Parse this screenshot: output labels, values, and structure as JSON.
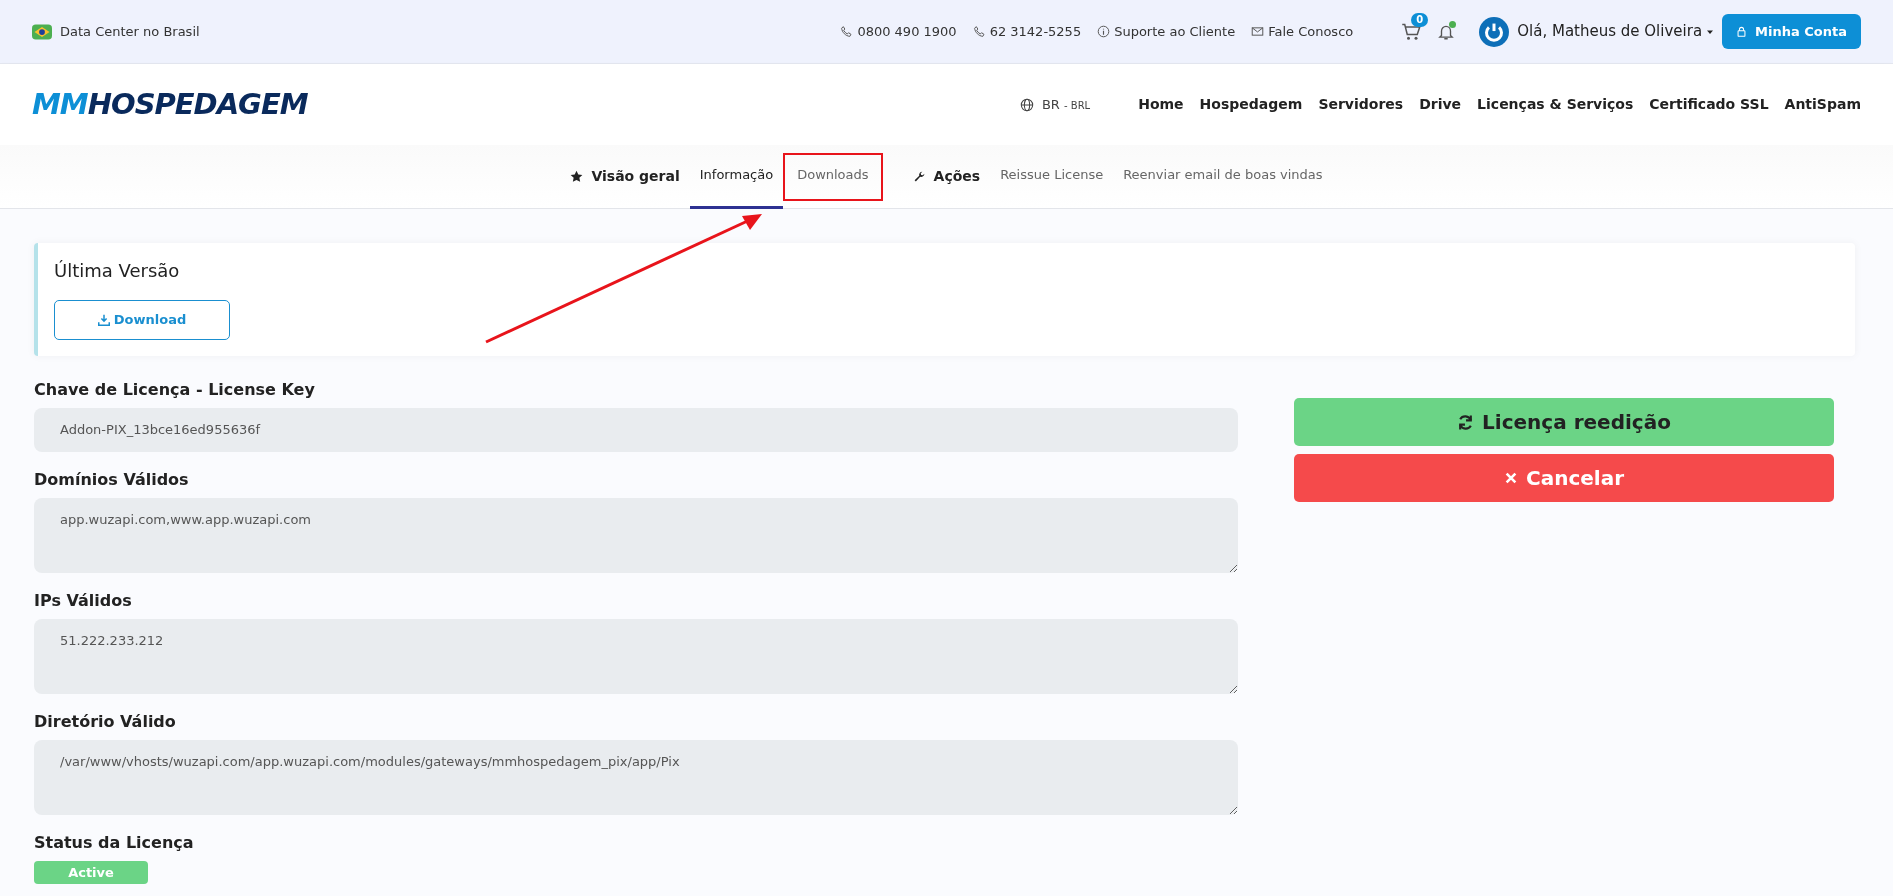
{
  "topbar": {
    "datacenter": "Data Center no Brasil",
    "links": [
      {
        "kind": "phone",
        "label": "0800 490 1900"
      },
      {
        "kind": "phone",
        "label": "62 3142-5255"
      },
      {
        "kind": "info",
        "label": "Suporte ao Cliente"
      },
      {
        "kind": "mail",
        "label": "Fale Conosco"
      }
    ],
    "cart_count": "0",
    "notification_dot": true,
    "greeting": "Olá, Matheus de Oliveira",
    "account_button": "Minha Conta"
  },
  "navbar": {
    "logo_part1": "MM",
    "logo_part2": "HOSPEDAGEM",
    "language": "BR",
    "currency": "- BRL",
    "items": [
      "Home",
      "Hospedagem",
      "Servidores",
      "Drive",
      "Licenças & Serviços",
      "Certificado SSL",
      "AntiSpam"
    ]
  },
  "subnav": [
    {
      "kind": "heading",
      "label": "Visão geral"
    },
    {
      "kind": "link",
      "label": "Informação",
      "selected": true,
      "highlighted": false
    },
    {
      "kind": "link",
      "label": "Downloads",
      "selected": false,
      "highlighted": true
    },
    {
      "kind": "heading",
      "label": "Ações"
    },
    {
      "kind": "link",
      "label": "Reissue License",
      "selected": false,
      "highlighted": false
    },
    {
      "kind": "link",
      "label": "Reenviar email de boas vindas",
      "selected": false,
      "highlighted": false
    }
  ],
  "latest_version": {
    "title": "Última Versão",
    "button": "Download"
  },
  "fields": [
    {
      "kind": "input",
      "label": "Chave de Licença - License Key",
      "value": "Addon-PIX_13bce16ed955636f"
    },
    {
      "kind": "textarea",
      "label": "Domínios Válidos",
      "value": "app.wuzapi.com,www.app.wuzapi.com"
    },
    {
      "kind": "textarea",
      "label": "IPs Válidos",
      "value": "51.222.233.212"
    },
    {
      "kind": "textarea",
      "label": "Diretório Válido",
      "value": "/var/www/vhosts/wuzapi.com/app.wuzapi.com/modules/gateways/mmhospedagem_pix/app/Pix"
    }
  ],
  "status": {
    "label": "Status da Licença",
    "value": "Active"
  },
  "actions": [
    {
      "kind": "reissue",
      "label": "Licença reedição"
    },
    {
      "kind": "cancel",
      "label": "Cancelar"
    }
  ]
}
